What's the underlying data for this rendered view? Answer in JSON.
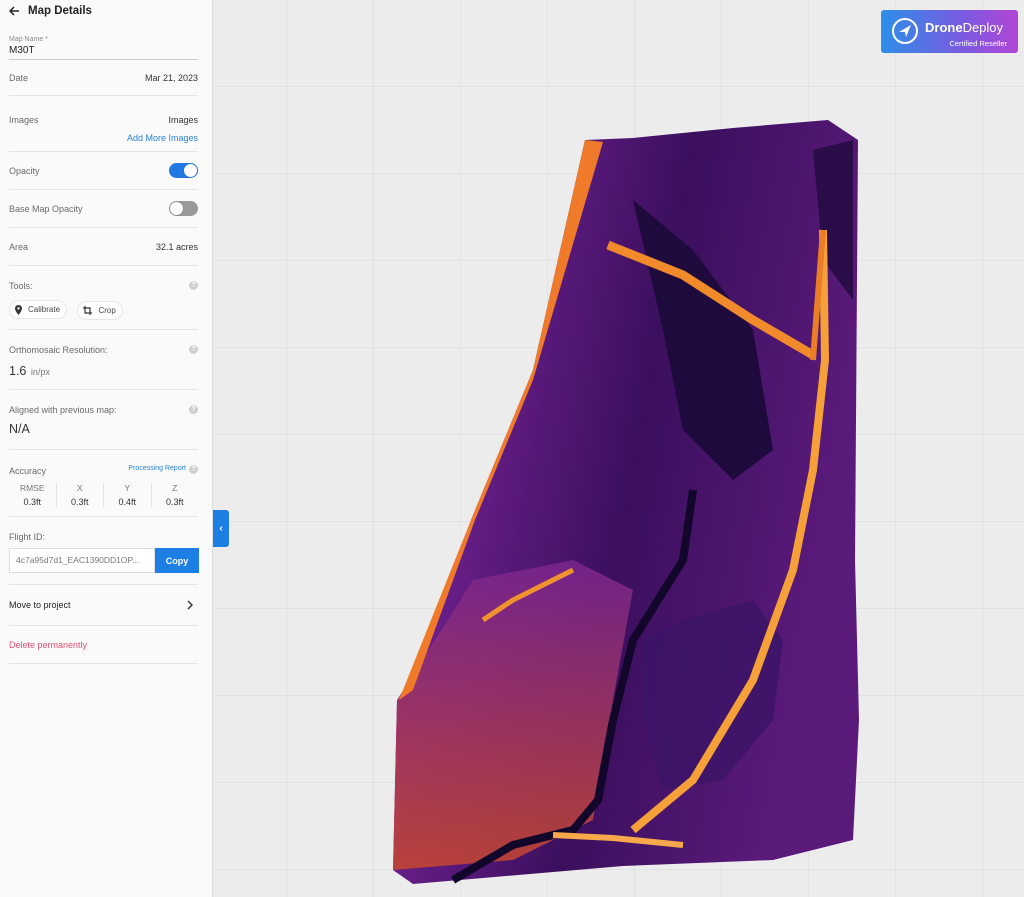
{
  "header": {
    "title": "Map Details"
  },
  "map_name": {
    "label": "Map Name *",
    "value": "M30T"
  },
  "date": {
    "label": "Date",
    "value": "Mar 21, 2023"
  },
  "images": {
    "label": "Images",
    "value": "Images",
    "add_link": "Add More Images"
  },
  "opacity": {
    "label": "Opacity",
    "enabled": true
  },
  "base_map_opacity": {
    "label": "Base Map Opacity",
    "enabled": false
  },
  "area": {
    "label": "Area",
    "value": "32.1 acres"
  },
  "tools": {
    "label": "Tools:",
    "calibrate": "Calibrate",
    "crop": "Crop"
  },
  "resolution": {
    "label": "Orthomosaic Resolution:",
    "value": "1.6",
    "unit": "in/px"
  },
  "aligned": {
    "label": "Aligned with previous map:",
    "value": "N/A"
  },
  "accuracy": {
    "label": "Accuracy",
    "report_link": "Processing Report",
    "columns": [
      {
        "name": "RMSE",
        "value": "0.3ft"
      },
      {
        "name": "X",
        "value": "0.3ft"
      },
      {
        "name": "Y",
        "value": "0.4ft"
      },
      {
        "name": "Z",
        "value": "0.3ft"
      }
    ]
  },
  "flight": {
    "label": "Flight ID:",
    "value": "4c7a95d7d1_EAC1390DD1OP...",
    "copy_label": "Copy"
  },
  "actions": {
    "move": "Move to project",
    "delete": "Delete permanently"
  },
  "badge": {
    "brand_bold": "Drone",
    "brand_rest": "Deploy",
    "subtitle": "Certified Reseller"
  },
  "icons": {
    "back": "back-arrow-icon",
    "help": "help-icon",
    "pin": "pin-icon",
    "crop": "crop-icon",
    "chevron": "chevron-right-icon",
    "collapse": "chevron-left-icon"
  },
  "colors": {
    "accent": "#1d7fe4",
    "danger": "#e2506e",
    "link": "#2b83d6"
  }
}
